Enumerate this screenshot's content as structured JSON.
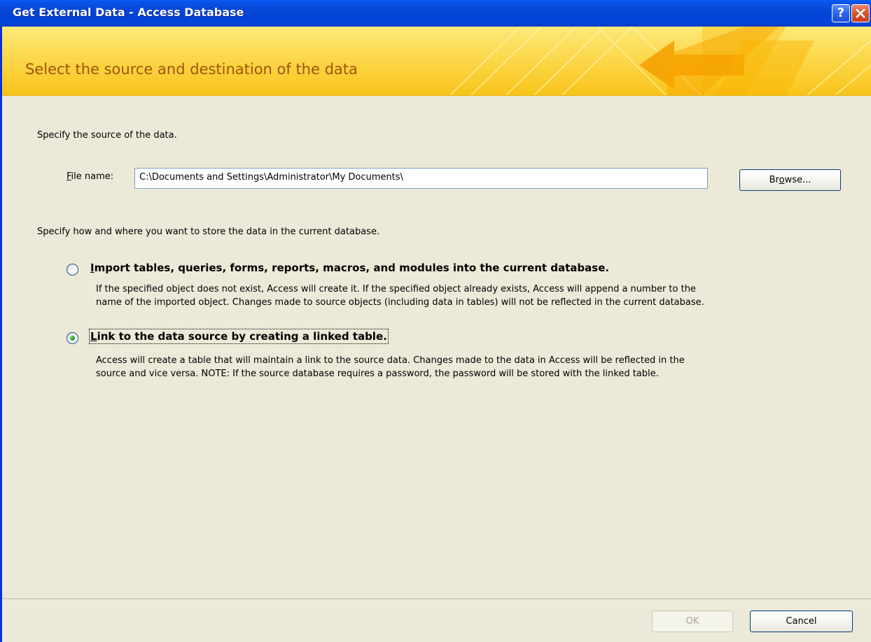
{
  "window": {
    "title": "Get External Data - Access Database",
    "help_glyph": "?",
    "accent_color": "#0A53E8",
    "banner_color": "#FCD84D"
  },
  "banner": {
    "heading": "Select the source and destination of the data"
  },
  "source": {
    "instruction": "Specify the source of the data.",
    "file_label_mnemonic": "F",
    "file_label_rest": "ile name:",
    "file_value": "C:\\Documents and Settings\\Administrator\\My Documents\\",
    "browse_pre": "Br",
    "browse_mnemonic": "o",
    "browse_post": "wse..."
  },
  "storage": {
    "instruction": "Specify how and where you want to store the data in the current database.",
    "options": [
      {
        "mnemonic": "I",
        "title_rest": "mport tables, queries, forms, reports, macros, and modules into the current database.",
        "line1": "If the specified object does not exist, Access will create it. If the specified object already exists, Access will append a number to the",
        "line2": "name of the imported object. Changes made to source objects (including data in tables) will not be reflected in the current database.",
        "selected": false
      },
      {
        "mnemonic": "L",
        "title_rest": "ink to the data source by creating a linked table.",
        "line1": "Access will create a table that will maintain a link to the source data. Changes made to the data in Access will be reflected in the",
        "line2": "source and vice versa. NOTE:  If the source database requires a password, the password will be stored with the linked table.",
        "selected": true
      }
    ]
  },
  "footer": {
    "ok_label": "OK",
    "cancel_label": "Cancel"
  }
}
